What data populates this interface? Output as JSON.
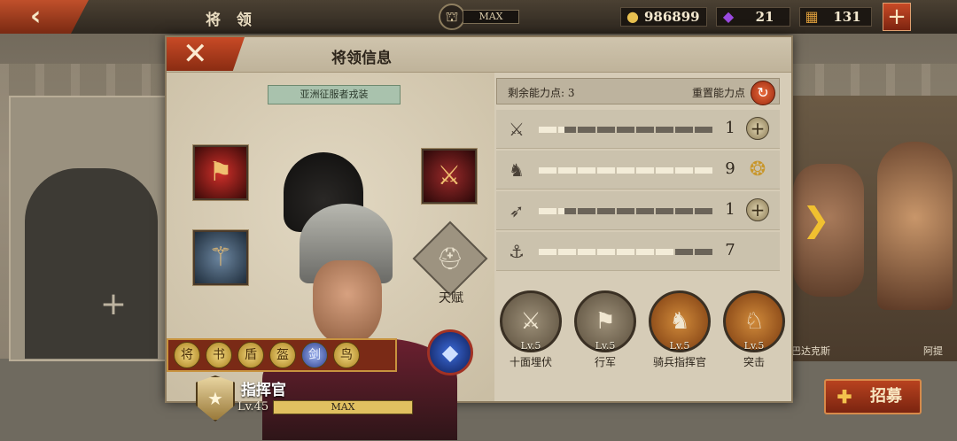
{
  "topbar": {
    "title": "将 领",
    "building_level": "MAX",
    "coins": "986899",
    "gems": "21",
    "ore": "131",
    "add_label": "+"
  },
  "background": {
    "left_slot_plus": "+",
    "right_general_1": "巴达克斯",
    "right_general_2": "阿提",
    "recruit_label": "招募"
  },
  "dialog": {
    "title": "将领信息",
    "close_label": "✕",
    "outfit_label": "亚洲征服者戎装",
    "talent_label": "天赋",
    "rank_name": "指挥官",
    "level_label": "Lv.45",
    "level_bar_text": "MAX",
    "skills": [
      "将",
      "书",
      "盾",
      "盔",
      "剑",
      "鸟"
    ],
    "points_label": "剩余能力点: 3",
    "reset_label": "重置能力点",
    "stats": [
      {
        "icon": "sword-icon",
        "value": "1",
        "fill": 0.15,
        "action": "plus"
      },
      {
        "icon": "horse-icon",
        "value": "9",
        "fill": 1.0,
        "action": "crest"
      },
      {
        "icon": "bow-icon",
        "value": "1",
        "fill": 0.15,
        "action": "plus"
      },
      {
        "icon": "anchor-icon",
        "value": "7",
        "fill": 0.78,
        "action": "none"
      }
    ],
    "abilities": [
      {
        "name": "十面埋伏",
        "level": "Lv.5",
        "style": "gray"
      },
      {
        "name": "行军",
        "level": "Lv.5",
        "style": "gray"
      },
      {
        "name": "骑兵指挥官",
        "level": "Lv.5",
        "style": "orange"
      },
      {
        "name": "突击",
        "level": "Lv.5",
        "style": "orange"
      }
    ]
  },
  "colors": {
    "accent_red": "#c84a26",
    "gold": "#e0c060",
    "panel": "#d6ccb7"
  }
}
